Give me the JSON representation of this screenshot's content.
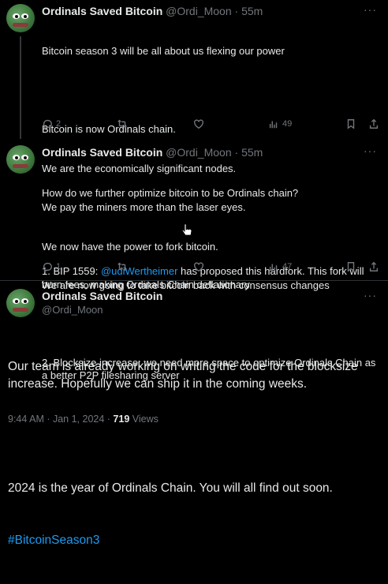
{
  "tweet1": {
    "name": "Ordinals Saved Bitcoin",
    "handle_time": "@Ordi_Moon · 55m",
    "more": "···",
    "lines": [
      "Bitcoin season 3 will be all about us flexing our power",
      "",
      "Bitcoin is now Ordinals chain.",
      "We are the economically significant nodes.",
      "We pay the miners more than the laser eyes.",
      "We now have the power to fork bitcoin.",
      "We are now going to take bitcoin back with consensus changes"
    ],
    "replies": "2",
    "retweets": "",
    "likes": "",
    "views": "49"
  },
  "tweet2": {
    "name": "Ordinals Saved Bitcoin",
    "handle_time": "@Ordi_Moon · 55m",
    "more": "···",
    "line1": "How do we further optimize bitcoin to be Ordinals chain?",
    "p1_prefix": "1. BIP 1559: ",
    "p1_mention": "@udiWertheimer",
    "p1_suffix": " has proposed this hardfork. This fork will burn fees, making Ordinals Chain deflationary",
    "p2": "2. Blocksize increase: we need more space to optimize Ordinals Chain as a better P2P filesharing server",
    "replies": "1",
    "views": "47"
  },
  "tweet3": {
    "name": "Ordinals Saved Bitcoin",
    "handle": "@Ordi_Moon",
    "more": "···",
    "para1": "Our team is already working on writing the code for the blocksize increase. Hopefully we can ship it in the coming weeks.",
    "para2": "2024 is the year of Ordinals Chain. You will all find out soon.",
    "hashtag": "#BitcoinSeason3",
    "timestamp": "9:44 AM · Jan 1, 2024 · ",
    "views_count": "719",
    "views_label": " Views"
  },
  "colors": {
    "background": "#000000",
    "text": "#e7e9ea",
    "secondary": "#71767b",
    "accent": "#1d9bf0"
  },
  "icons": [
    "reply-icon",
    "retweet-icon",
    "like-icon",
    "views-icon",
    "bookmark-icon",
    "share-icon",
    "more-icon",
    "avatar-pepe"
  ]
}
